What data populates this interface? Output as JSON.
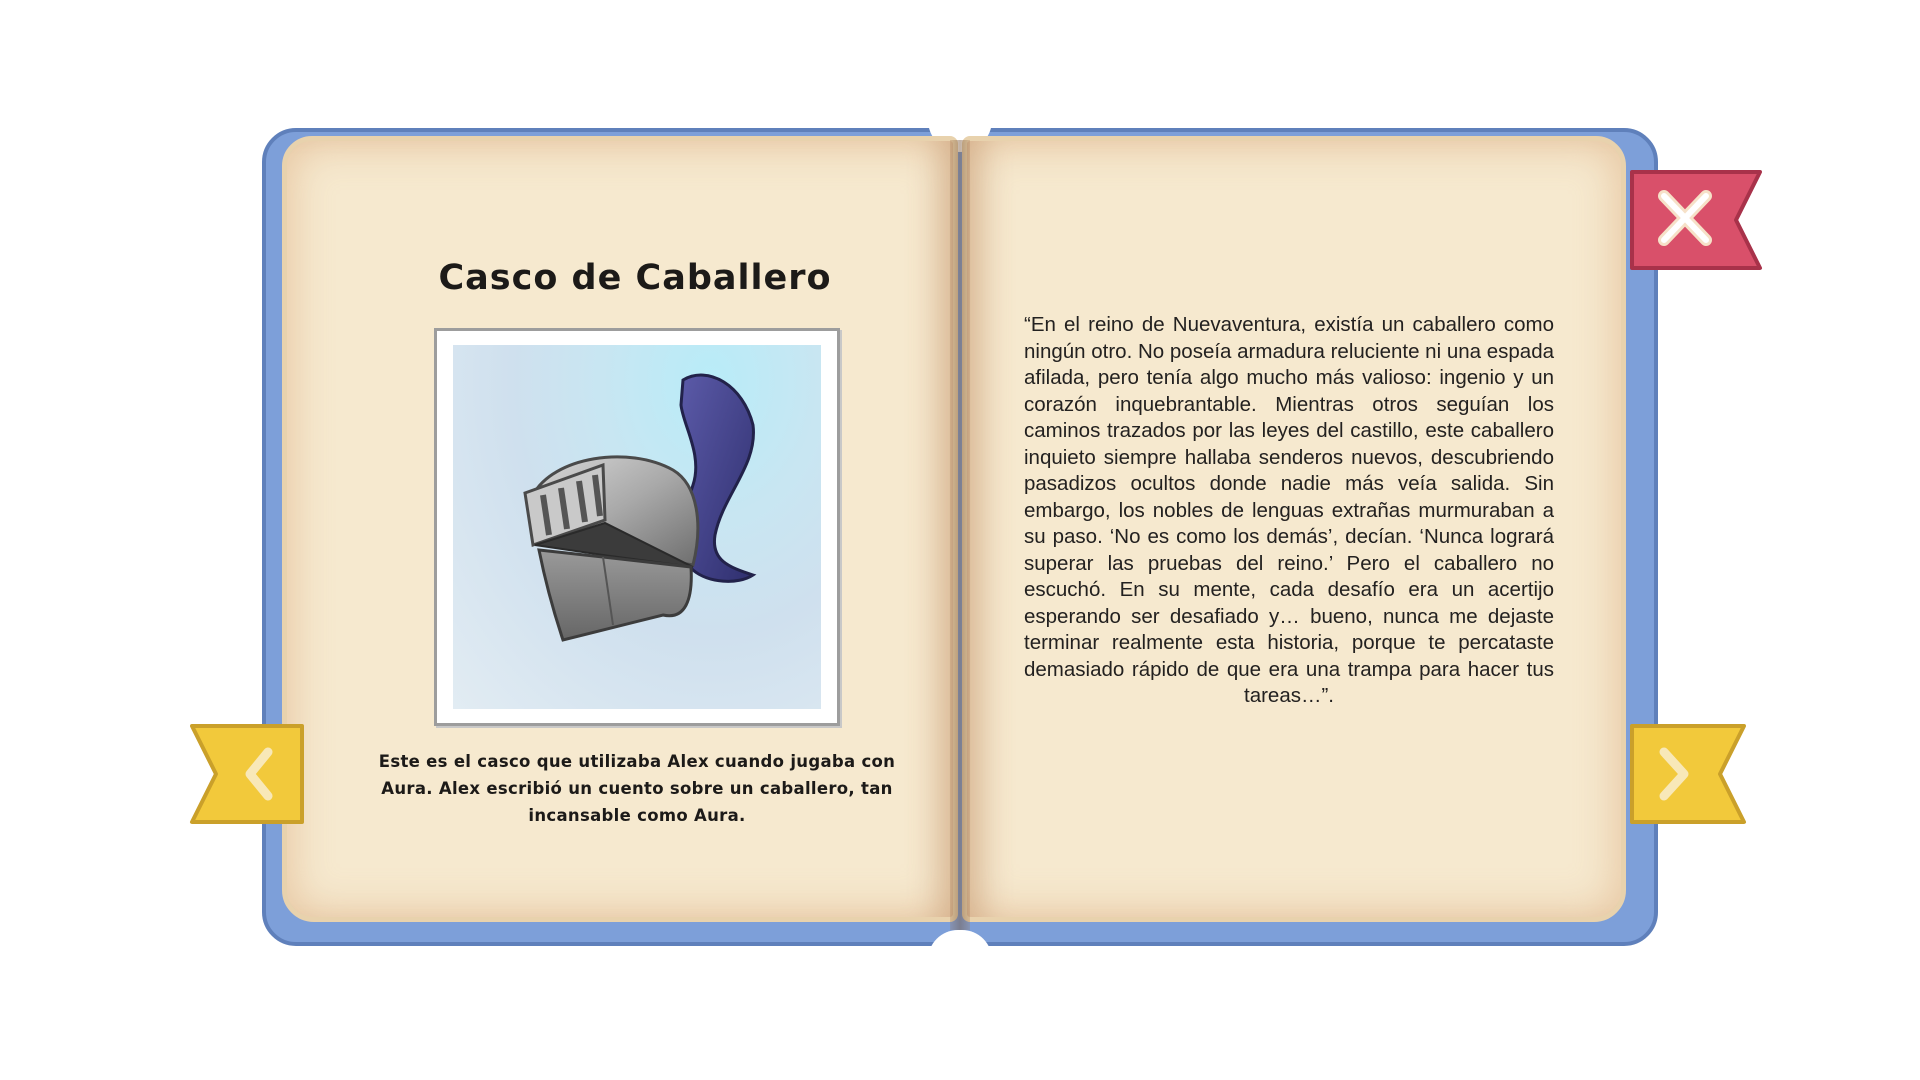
{
  "item": {
    "title": "Casco de Caballero",
    "image_subject": "knight-helmet-illustration",
    "caption": "Este es el casco que utilizaba Alex cuando jugaba con Aura. Alex escribió un cuento sobre un caballero, tan incansable como Aura."
  },
  "story": {
    "text": "“En el reino de Nuevaventura, existía un caballero como ningún otro. No poseía armadura reluciente ni una espada afilada, pero tenía algo mucho más valioso: ingenio y un corazón inquebrantable. Mientras otros seguían los caminos trazados por las leyes del castillo, este caballero inquieto siempre hallaba senderos nuevos, descubriendo pasadizos ocultos donde nadie más veía salida. Sin embargo, los nobles de lenguas extrañas murmuraban a su paso. ‘No es como los demás’, decían. ‘Nunca logrará superar las pruebas del reino.’ Pero el caballero no escuchó. En su mente, cada desafío era un acertijo esperando ser desafiado y… bueno, nunca me dejaste terminar realmente esta historia, porque te percataste demasiado rápido de que era una trampa para hacer tus tareas…”."
  },
  "controls": {
    "close_icon": "close-x-icon",
    "prev_icon": "chevron-left-icon",
    "next_icon": "chevron-right-icon"
  },
  "colors": {
    "cover": "#7d9fd9",
    "page": "#f6e9cf",
    "close_ribbon": "#d9506a",
    "nav_ribbon": "#f2c93b"
  }
}
